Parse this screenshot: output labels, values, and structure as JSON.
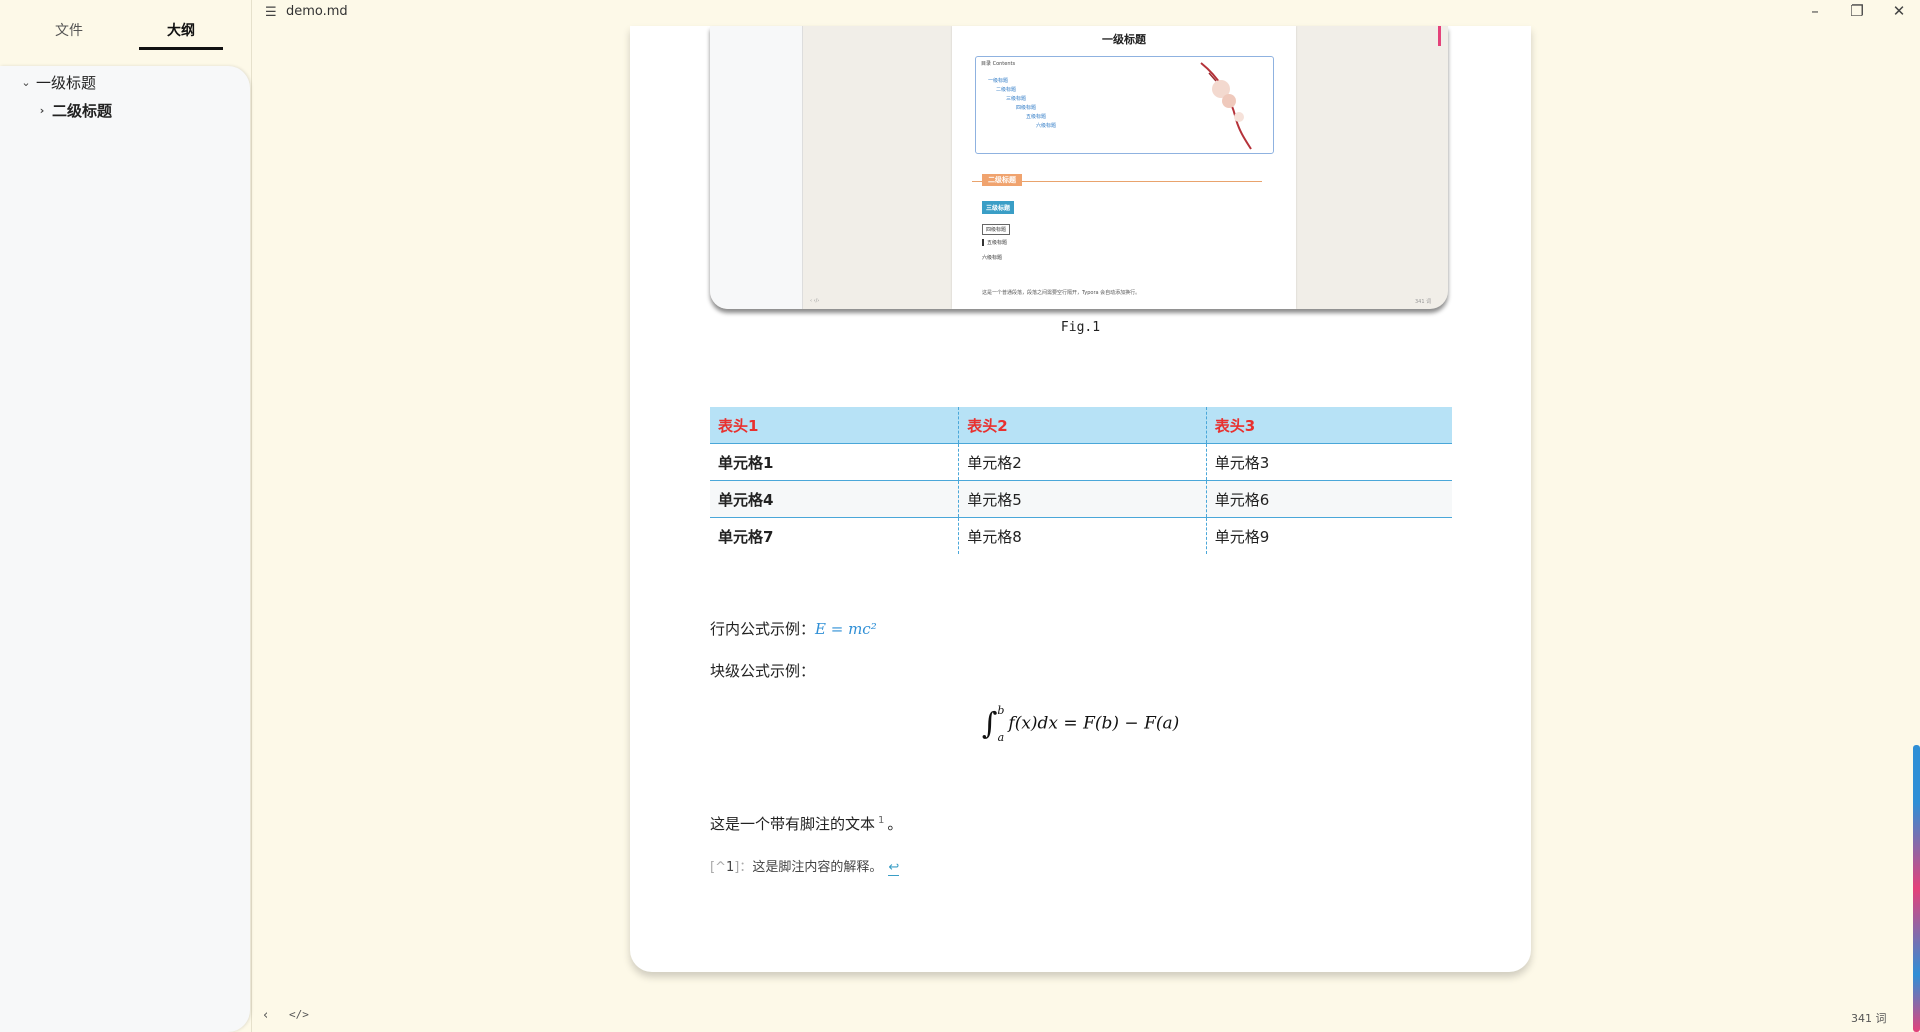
{
  "window": {
    "title": "demo.md",
    "minimize": "–",
    "maximize": "❐",
    "close": "✕"
  },
  "sidebar": {
    "tabs": [
      "文件",
      "大纲"
    ],
    "active_tab": "大纲",
    "outline": [
      {
        "label": "一级标题",
        "expanded": true
      },
      {
        "label": "二级标题",
        "expanded": false
      }
    ]
  },
  "figure": {
    "doc_title": "一级标题",
    "toc_title": "目录 Contents",
    "toc_items": [
      "一级标题",
      "二级标题",
      "三级标题",
      "四级标题",
      "五级标题",
      "六级标题"
    ],
    "h2": "二级标题",
    "h3": "三级标题",
    "h4": "四级标题",
    "h5": "五级标题",
    "h6": "六级标题",
    "para": "这是一个普通段落，段落之间需要空行隔开，Typora 会自动添加换行。",
    "status_left": "‹ ‹/›",
    "status_right": "341 词",
    "caption": "Fig.1"
  },
  "table": {
    "headers": [
      "表头1",
      "表头2",
      "表头3"
    ],
    "rows": [
      [
        "单元格1",
        "单元格2",
        "单元格3"
      ],
      [
        "单元格4",
        "单元格5",
        "单元格6"
      ],
      [
        "单元格7",
        "单元格8",
        "单元格9"
      ]
    ]
  },
  "content": {
    "inline_formula_label": "行内公式示例：",
    "inline_formula": "E = mc²",
    "block_formula_label": "块级公式示例：",
    "block_formula_upper": "b",
    "block_formula_lower": "a",
    "block_formula_body": "f(x)dx = F(b) − F(a)",
    "footnote_text": "这是一个带有脚注的文本",
    "footnote_ref": "1",
    "footnote_end": "。",
    "footnote_def_open": "[^",
    "footnote_def_num": "1",
    "footnote_def_close": "]：",
    "footnote_def_text": "这是脚注内容的解释。",
    "footnote_back": "↩"
  },
  "statusbar": {
    "back_icon": "‹",
    "source_icon": "</>",
    "word_count": "341 词"
  }
}
